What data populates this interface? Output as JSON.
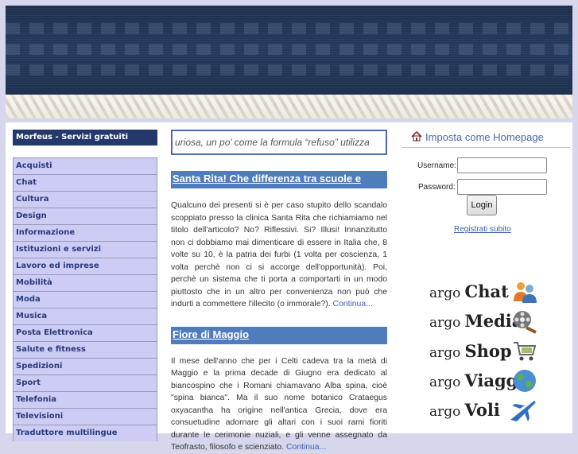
{
  "sidebar": {
    "title": "Morfeus - Servizi gratuiti",
    "items": [
      "Acquisti",
      "Chat",
      "Cultura",
      "Design",
      "Informazione",
      "Istituzioni e servizi",
      "Lavoro ed imprese",
      "Mobilità",
      "Moda",
      "Musica",
      "Posta Elettronica",
      "Salute e fitness",
      "Spedizioni",
      "Sport",
      "Telefonia",
      "Televisioni",
      "Traduttore multilingue"
    ]
  },
  "ticker": {
    "text": "uriosa, un po’ come la formula “refuso” utilizza"
  },
  "posts": [
    {
      "title": "Santa Rita! Che differenza tra scuole e ospedali?",
      "body": "Qualcuno dei presenti si è per caso stupito dello scandalo scoppiato presso la clinica Santa Rita che richiamiamo nel titolo dell'articolo? No? Riflessivi. Si? Illusi! Innanzitutto non ci dobbiamo mai dimenticare di essere in Italia che, 8 volte su 10, è la patria dei furbi (1 volta per coscienza, 1 volta perchè non ci si accorge dell'opportunità). Poi, perchè un sistema che ti porta a comportarti in un modo piuttosto che in un altro per convenienza non può che indurti a commettere l'illecito (o immorale?).",
      "more": "Continua..."
    },
    {
      "title": "Fiore di Maggio",
      "body": "Il mese dell'anno che per i Celti cadeva tra la metà di Maggio e la prima decade di Giugno era dedicato al biancospino che i Romani chiamavano Alba spina, cioè \"spina bianca\". Ma il suo nome botanico Crataegus oxyacantha ha origine nell'antica Grecia, dove era consuetudine adornare gli altari con i suoi rami fioriti durante le cerimonie nuziali, e gli venne assegnato da Teofrasto, filosofo e scienziato.",
      "more": "Continua..."
    }
  ],
  "right": {
    "homepage_label": "Imposta come Homepage",
    "username_label": "Username:",
    "password_label": "Password:",
    "username_value": "",
    "password_value": "",
    "login_label": "Login",
    "register_label": "Registrati subito",
    "argo": [
      {
        "prefix": "argo",
        "word": "Chat",
        "icon": "users-icon"
      },
      {
        "prefix": "argo",
        "word": "Media",
        "icon": "film-reel-icon"
      },
      {
        "prefix": "argo",
        "word": "Shop",
        "icon": "cart-icon"
      },
      {
        "prefix": "argo",
        "word": "Viaggi",
        "icon": "globe-icon"
      },
      {
        "prefix": "argo",
        "word": "Voli",
        "icon": "airplane-icon"
      }
    ]
  },
  "colors": {
    "page_bg": "#d6d6ec",
    "header": "#233a5e",
    "menu_bg": "#ccccf4",
    "menu_text": "#2a3a7a",
    "post_title_bg": "#4f7cbd",
    "link": "#3a62b0"
  }
}
